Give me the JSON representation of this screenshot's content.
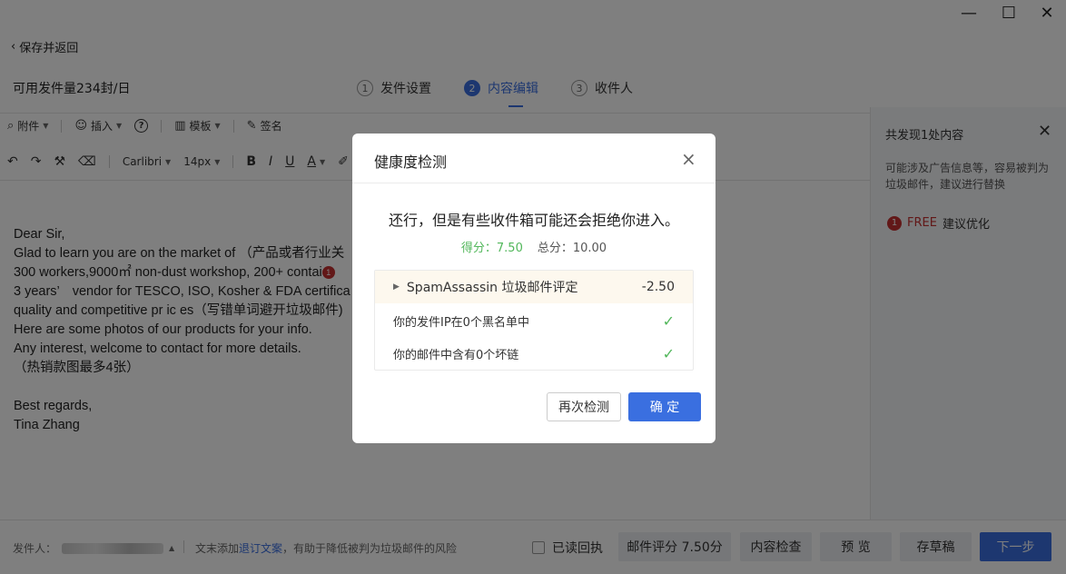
{
  "window": {
    "minimize": "—",
    "maximize": "☐",
    "close": "✕"
  },
  "header": {
    "back_label": "保存并返回",
    "quota": "可用发件量234封/日",
    "steps": [
      {
        "num": "1",
        "label": "发件设置"
      },
      {
        "num": "2",
        "label": "内容编辑"
      },
      {
        "num": "3",
        "label": "收件人"
      }
    ]
  },
  "toolbar": {
    "attach": "附件",
    "insert": "插入",
    "help": "?",
    "template": "模板",
    "signature": "签名",
    "font": "Carlibri",
    "size": "14px",
    "bold": "B",
    "italic": "I",
    "underline": "U",
    "color": "A"
  },
  "editor": {
    "lines": [
      "Dear Sir,",
      "Glad to learn you are on the market of （产品或者行业关",
      "300 workers,9000㎡ non-dust workshop, 200+ contai",
      "3 years’　vendor for TESCO, ISO, Kosher & FDA certifica",
      "quality and competitive pr ic es（写错单词避开垃圾邮件)",
      "Here are some photos of our products for your info.",
      "Any interest, welcome to contact for more details.",
      "（热销款图最多4张）",
      "",
      "Best regards,",
      "Tina Zhang"
    ],
    "badge": "1"
  },
  "right_panel": {
    "title": "共发现1处内容",
    "desc": "可能涉及广告信息等，容易被判为垃圾邮件，建议进行替换",
    "badge": "1",
    "free_label": "FREE",
    "suggest": "建议优化"
  },
  "footer": {
    "sender_label": "发件人：",
    "tip_prefix": "文末添加",
    "tip_link": "退订文案",
    "tip_suffix": "，有助于降低被判为垃圾邮件的风险",
    "read_receipt": "已读回执",
    "score_btn": "邮件评分 7.50分",
    "check_btn": "内容检查",
    "preview_btn": "预 览",
    "draft_btn": "存草稿",
    "next_btn": "下一步"
  },
  "modal": {
    "title": "健康度检测",
    "message": "还行，但是有些收件箱可能还会拒绝你进入。",
    "score_label": "得分：7.50",
    "total_label": "总分：10.00",
    "rows": [
      {
        "label": "SpamAssassin 垃圾邮件评定",
        "value": "-2.50"
      },
      {
        "label": "你的发件IP在0个黑名单中",
        "value": "✓"
      },
      {
        "label": "你的邮件中含有0个坏链",
        "value": "✓"
      }
    ],
    "recheck_btn": "再次检测",
    "ok_btn": "确 定"
  },
  "colors": {
    "accent": "#3a6fe0",
    "good": "#52b75b",
    "warn": "#c43030",
    "overlay": "rgba(0,0,0,0.5)"
  }
}
